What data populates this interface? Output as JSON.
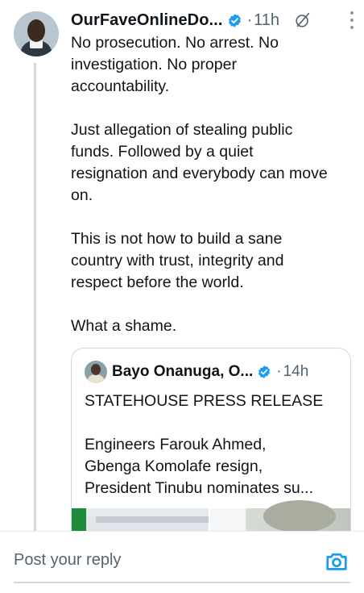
{
  "post": {
    "author": "OurFaveOnlineDo...",
    "separator": "·",
    "time": "11h",
    "paragraphs": [
      "No prosecution. No arrest. No\ninvestigation. No proper\naccountability.",
      "Just allegation of stealing public\nfunds. Followed by a quiet\nresignation and everybody can move\non.",
      "This is not how to build a sane\ncountry with trust, integrity and\nrespect before the world.",
      "What a shame."
    ]
  },
  "quote": {
    "author": "Bayo Onanuga, O...",
    "separator": "·",
    "time": "14h",
    "title": "STATEHOUSE PRESS RELEASE",
    "lines": [
      "Engineers Farouk Ahmed,",
      "Gbenga Komolafe resign,",
      "President Tinubu nominates su..."
    ]
  },
  "reply": {
    "placeholder": "Post your reply"
  },
  "colors": {
    "verified_blue": "#1d9bf0",
    "secondary_text": "#536471",
    "border": "#cfd9de"
  },
  "icons": [
    "verified-badge-icon",
    "grok-icon",
    "more-options-icon",
    "camera-icon"
  ]
}
